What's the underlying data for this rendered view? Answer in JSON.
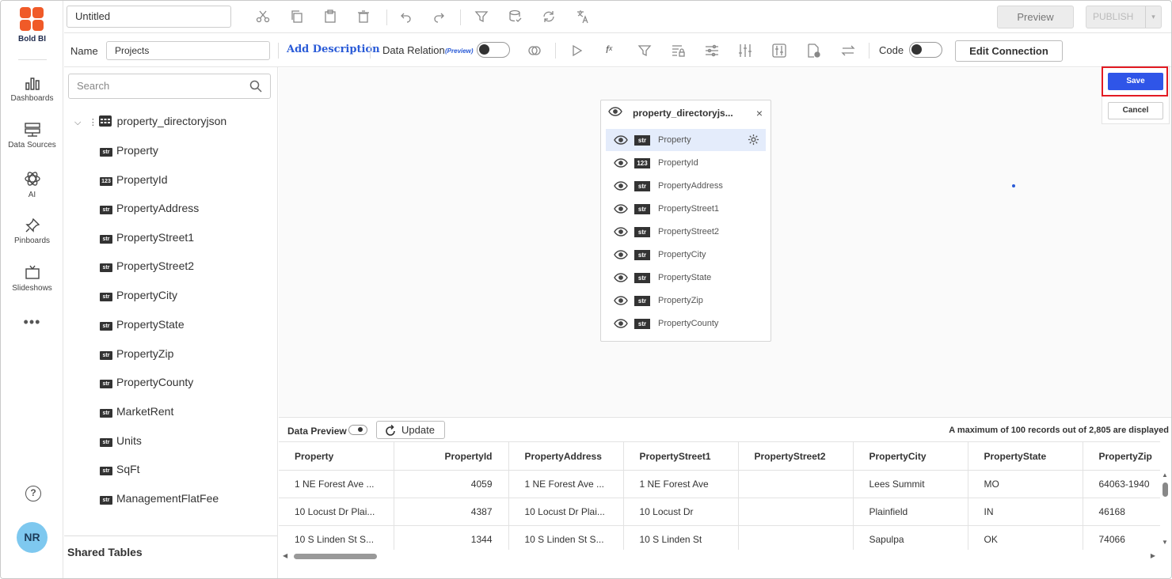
{
  "app": {
    "logo_text": "Bold BI"
  },
  "nav": {
    "items": [
      {
        "label": "Dashboards",
        "icon": "dashboards-icon"
      },
      {
        "label": "Data Sources",
        "icon": "data-sources-icon"
      },
      {
        "label": "AI",
        "icon": "ai-icon"
      },
      {
        "label": "Pinboards",
        "icon": "pin-icon"
      },
      {
        "label": "Slideshows",
        "icon": "slideshow-icon"
      }
    ],
    "more": "•••",
    "help": "?",
    "avatar": "NR"
  },
  "toolbar": {
    "title_value": "Untitled",
    "preview_label": "Preview",
    "publish_label": "PUBLISH",
    "caret": "▾"
  },
  "subbar": {
    "name_label": "Name",
    "name_value": "Projects",
    "add_description": "Add Description",
    "data_relation": "Data Relation",
    "preview_tag": "(Preview)",
    "fx": "fˣ",
    "code_label": "Code",
    "edit_connection": "Edit Connection"
  },
  "sidebar": {
    "search_placeholder": "Search",
    "root": "property_directoryjson",
    "fields": [
      {
        "type": "str",
        "name": "Property"
      },
      {
        "type": "123",
        "name": "PropertyId"
      },
      {
        "type": "str",
        "name": "PropertyAddress"
      },
      {
        "type": "str",
        "name": "PropertyStreet1"
      },
      {
        "type": "str",
        "name": "PropertyStreet2"
      },
      {
        "type": "str",
        "name": "PropertyCity"
      },
      {
        "type": "str",
        "name": "PropertyState"
      },
      {
        "type": "str",
        "name": "PropertyZip"
      },
      {
        "type": "str",
        "name": "PropertyCounty"
      },
      {
        "type": "str",
        "name": "MarketRent"
      },
      {
        "type": "str",
        "name": "Units"
      },
      {
        "type": "str",
        "name": "SqFt"
      },
      {
        "type": "str",
        "name": "ManagementFlatFee"
      }
    ],
    "shared_tables": "Shared Tables"
  },
  "card": {
    "title": "property_directoryjs...",
    "close": "×",
    "rows": [
      {
        "type": "str",
        "name": "Property"
      },
      {
        "type": "123",
        "name": "PropertyId"
      },
      {
        "type": "str",
        "name": "PropertyAddress"
      },
      {
        "type": "str",
        "name": "PropertyStreet1"
      },
      {
        "type": "str",
        "name": "PropertyStreet2"
      },
      {
        "type": "str",
        "name": "PropertyCity"
      },
      {
        "type": "str",
        "name": "PropertyState"
      },
      {
        "type": "str",
        "name": "PropertyZip"
      },
      {
        "type": "str",
        "name": "PropertyCounty"
      }
    ]
  },
  "actions": {
    "save": "Save",
    "cancel": "Cancel",
    "highlight_color": "#e31b23",
    "save_color": "#2f55e8"
  },
  "data_preview": {
    "label": "Data Preview",
    "update": "Update",
    "info": "A maximum of 100 records out of 2,805 are displayed",
    "columns": [
      "Property",
      "PropertyId",
      "PropertyAddress",
      "PropertyStreet1",
      "PropertyStreet2",
      "PropertyCity",
      "PropertyState",
      "PropertyZip"
    ],
    "rows": [
      [
        "1 NE Forest Ave ...",
        "4059",
        "1 NE Forest Ave ...",
        "1 NE Forest Ave",
        "",
        "Lees Summit",
        "MO",
        "64063-1940"
      ],
      [
        "10 Locust Dr Plai...",
        "4387",
        "10 Locust Dr Plai...",
        "10 Locust Dr",
        "",
        "Plainfield",
        "IN",
        "46168"
      ],
      [
        "10 S Linden St S...",
        "1344",
        "10 S Linden St S...",
        "10 S Linden St",
        "",
        "Sapulpa",
        "OK",
        "74066"
      ]
    ]
  }
}
